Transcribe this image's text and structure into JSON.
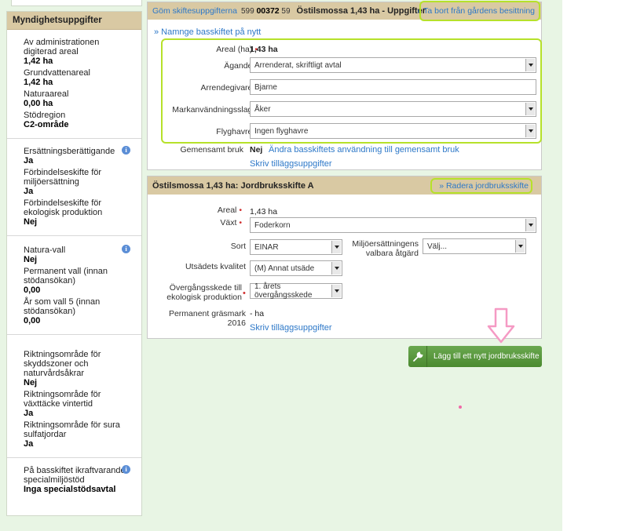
{
  "sidebar": {
    "header": "Myndighetsuppgifter",
    "group1": [
      {
        "label": "Av administrationen digiterad areal",
        "value": "1,42 ha"
      },
      {
        "label": "Grundvattenareal",
        "value": "1,42 ha"
      },
      {
        "label": "Naturaareal",
        "value": "0,00 ha"
      },
      {
        "label": "Stödregion",
        "value": "C2-område"
      }
    ],
    "group2": [
      {
        "label": "Ersättningsberättigande",
        "value": "Ja"
      },
      {
        "label": "Förbindelseskifte för miljöersättning",
        "value": "Ja"
      },
      {
        "label": "Förbindelseskifte för ekologisk produktion",
        "value": "Nej"
      }
    ],
    "group3": [
      {
        "label": "Natura-vall",
        "value": "Nej"
      },
      {
        "label": "Permanent vall (innan stödansökan)",
        "value": "0,00"
      },
      {
        "label": "År som vall 5 (innan stödansökan)",
        "value": "0,00"
      }
    ],
    "group4": [
      {
        "label": "Riktningsområde för skyddszoner och naturvårdsåkrar",
        "value": "Nej"
      },
      {
        "label": "Riktningsområde för växttäcke vintertid",
        "value": "Ja"
      },
      {
        "label": "Riktningsområde för sura sulfatjordar",
        "value": "Ja"
      }
    ],
    "group5": [
      {
        "label": "På basskiftet ikraftvarande specialmiljöstöd",
        "value": "Inga specialstödsavtal"
      }
    ],
    "info_icon": "i"
  },
  "panel1": {
    "hide_link": "Göm skiftesuppgifterna",
    "block_prefix": "599",
    "block_bold": "00372",
    "block_suffix": "59",
    "title": "Östilsmossa 1,43 ha - Uppgifter",
    "remove_link": "» Ta bort från gårdens besittning",
    "rename_link": "» Namnge basskiftet på nytt",
    "areal_label": "Areal (ha)",
    "areal_value": "1,43 ha",
    "agande_label": "Ägande",
    "agande_value": "Arrenderat, skriftligt avtal",
    "arrendegivare_label": "Arrendegivare",
    "arrendegivare_value": "Bjarne",
    "markanv_label": "Markanvändningsslag",
    "markanv_value": "Åker",
    "flyghavre_label": "Flyghavre",
    "flyghavre_value": "Ingen flyghavre",
    "gemensamt_label": "Gemensamt bruk",
    "gemensamt_value": "Nej",
    "gemensamt_link": "Ändra basskiftets användning till gemensamt bruk",
    "extra_link": "Skriv tilläggsuppgifter"
  },
  "panel2": {
    "title": "Östilsmossa 1,43 ha: Jordbruksskifte A",
    "delete_link": "» Radera jordbruksskifte",
    "areal_label": "Areal",
    "areal_value": "1,43  ha",
    "vaxt_label": "Växt",
    "vaxt_value": "Foderkorn",
    "sort_label": "Sort",
    "sort_value": "EINAR",
    "miljo_label": "Miljöersättningens valbara åtgärd",
    "miljo_value": "Välj...",
    "utsade_label": "Utsädets kvalitet",
    "utsade_value": "(M) Annat utsäde",
    "overgang_label": "Övergångsskede till ekologisk produktion",
    "overgang_value": "1. årets övergångsskede",
    "permanent_label": "Permanent gräsmark 2016",
    "permanent_value": "- ha",
    "extra_link": "Skriv tilläggsuppgifter"
  },
  "add_button": "Lägg till ett nytt jordbruksskifte",
  "required_mark": "•",
  "colors": {
    "header_bg": "#d9c9a3",
    "link": "#2d78c8",
    "highlight": "#b6e12a",
    "button": "#5a9a3e",
    "pink_arrow": "#f59ac4"
  }
}
